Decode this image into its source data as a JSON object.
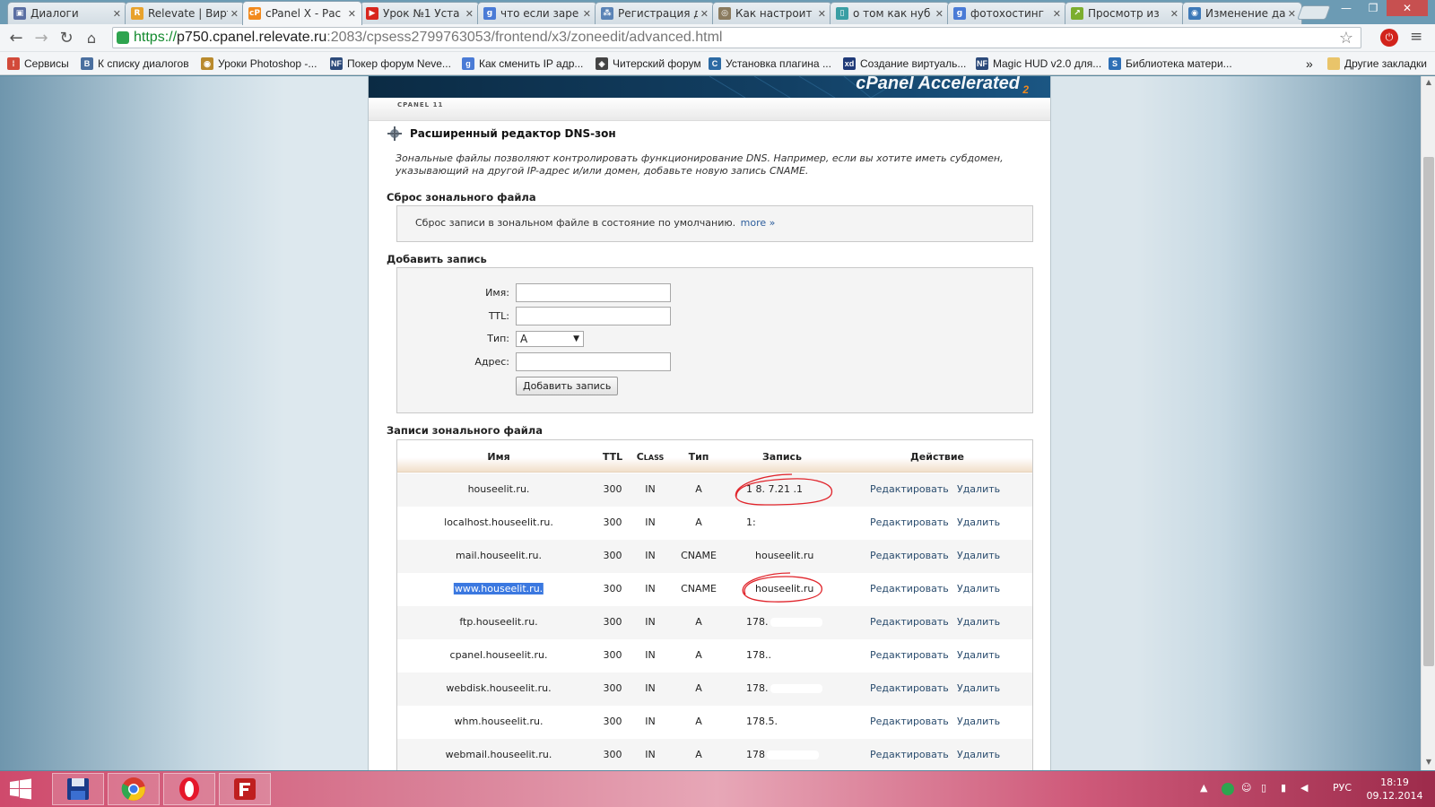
{
  "browser": {
    "tabs": [
      {
        "label": "Диалоги",
        "icon": "dialogs-icon",
        "color": "#5a6fa3",
        "glyph": "▣"
      },
      {
        "label": "Relevate | Вирт",
        "icon": "relevate-icon",
        "color": "#e8a22c",
        "glyph": "R"
      },
      {
        "label": "cPanel X - Рас",
        "icon": "cpanel-icon",
        "color": "#f28a1d",
        "glyph": "cP",
        "active": true
      },
      {
        "label": "Урок №1 Уста",
        "icon": "youtube-icon",
        "color": "#d8261e",
        "glyph": "▶"
      },
      {
        "label": "что если заре",
        "icon": "google-icon",
        "color": "#4a7bd6",
        "glyph": "g"
      },
      {
        "label": "Регистрация д",
        "icon": "network-icon",
        "color": "#5a83b6",
        "glyph": "⁂"
      },
      {
        "label": "Как настроит",
        "icon": "forum-icon",
        "color": "#8a7a5e",
        "glyph": "◎"
      },
      {
        "label": "о том как нуб",
        "icon": "page-icon",
        "color": "#3a9ea4",
        "glyph": "▯"
      },
      {
        "label": "фотохостинг",
        "icon": "google-icon",
        "color": "#4a7bd6",
        "glyph": "g"
      },
      {
        "label": "Просмотр из",
        "icon": "arrow-icon",
        "color": "#7cae2e",
        "glyph": "↗"
      },
      {
        "label": "Изменение да",
        "icon": "globe-icon",
        "color": "#3d79b8",
        "glyph": "◉"
      }
    ],
    "url": {
      "scheme": "https://",
      "host": "p750.cpanel.relevate.ru",
      "path": ":2083/cpsess2799763053/frontend/x3/zoneedit/advanced.html"
    },
    "bookmarks": [
      {
        "label": "Сервисы",
        "icon": "apps-icon",
        "color": "#d24a3a",
        "glyph": "⁞"
      },
      {
        "label": "К списку диалогов",
        "icon": "vk-icon",
        "color": "#4a6f9f",
        "glyph": "B"
      },
      {
        "label": "Уроки Photoshop -...",
        "icon": "photoshop-icon",
        "color": "#b98a2d",
        "glyph": "◉"
      },
      {
        "label": "Покер форум Neve...",
        "icon": "nf-icon",
        "color": "#2c4a7a",
        "glyph": "NF"
      },
      {
        "label": "Как сменить IP адр...",
        "icon": "google-icon",
        "color": "#4a7bd6",
        "glyph": "g"
      },
      {
        "label": "Читерский форум",
        "icon": "cheat-icon",
        "color": "#444444",
        "glyph": "◈"
      },
      {
        "label": "Установка плагина ...",
        "icon": "plugin-icon",
        "color": "#2c6aa3",
        "glyph": "C"
      },
      {
        "label": "Создание виртуаль...",
        "icon": "xd-icon",
        "color": "#1f3a78",
        "glyph": "xd"
      },
      {
        "label": "Magic HUD v2.0 для...",
        "icon": "nf-icon",
        "color": "#2c4a7a",
        "glyph": "NF"
      },
      {
        "label": "Библиотека матери...",
        "icon": "library-icon",
        "color": "#2e6fb5",
        "glyph": "S"
      }
    ],
    "bookmarks_more": "»",
    "other_bookmarks": "Другие закладки"
  },
  "page": {
    "banner": "cPanel Accelerated",
    "banner_sub": "2",
    "brand": "CPANEL 11",
    "title": "Расширенный редактор DNS-зон",
    "description": "Зональные файлы позволяют контролировать функционирование DNS. Например, если вы хотите иметь субдомен, указывающий на другой IP-адрес и/или домен, добавьте новую запись CNAME.",
    "reset": {
      "heading": "Сброс зонального файла",
      "text": "Сброс записи в зональном файле в состояние по умолчанию.",
      "more": "more »"
    },
    "add": {
      "heading": "Добавить запись",
      "name_label": "Имя:",
      "ttl_label": "TTL:",
      "type_label": "Тип:",
      "type_value": "A",
      "address_label": "Адрес:",
      "button": "Добавить запись"
    },
    "records": {
      "heading": "Записи зонального файла",
      "columns": {
        "name": "Имя",
        "ttl": "TTL",
        "class": "Class",
        "type": "Тип",
        "record": "Запись",
        "action": "Действие"
      },
      "edit": "Редактировать",
      "delete": "Удалить",
      "rows": [
        {
          "name": "houseelit.ru.",
          "ttl": "300",
          "class": "IN",
          "type": "A",
          "record": "1 8. 7.21 .1"
        },
        {
          "name": "localhost.houseelit.ru.",
          "ttl": "300",
          "class": "IN",
          "type": "A",
          "record": "1:"
        },
        {
          "name": "mail.houseelit.ru.",
          "ttl": "300",
          "class": "IN",
          "type": "CNAME",
          "record": "houseelit.ru"
        },
        {
          "name": "www.houseelit.ru.",
          "ttl": "300",
          "class": "IN",
          "type": "CNAME",
          "record": "houseelit.ru",
          "selected": true
        },
        {
          "name": "ftp.houseelit.ru.",
          "ttl": "300",
          "class": "IN",
          "type": "A",
          "record": "178."
        },
        {
          "name": "cpanel.houseelit.ru.",
          "ttl": "300",
          "class": "IN",
          "type": "A",
          "record": "178.."
        },
        {
          "name": "webdisk.houseelit.ru.",
          "ttl": "300",
          "class": "IN",
          "type": "A",
          "record": "178."
        },
        {
          "name": "whm.houseelit.ru.",
          "ttl": "300",
          "class": "IN",
          "type": "A",
          "record": "178.5."
        },
        {
          "name": "webmail.houseelit.ru.",
          "ttl": "300",
          "class": "IN",
          "type": "A",
          "record": "178"
        }
      ]
    }
  },
  "taskbar": {
    "language": "РУС",
    "time": "18:19",
    "date": "09.12.2014"
  }
}
